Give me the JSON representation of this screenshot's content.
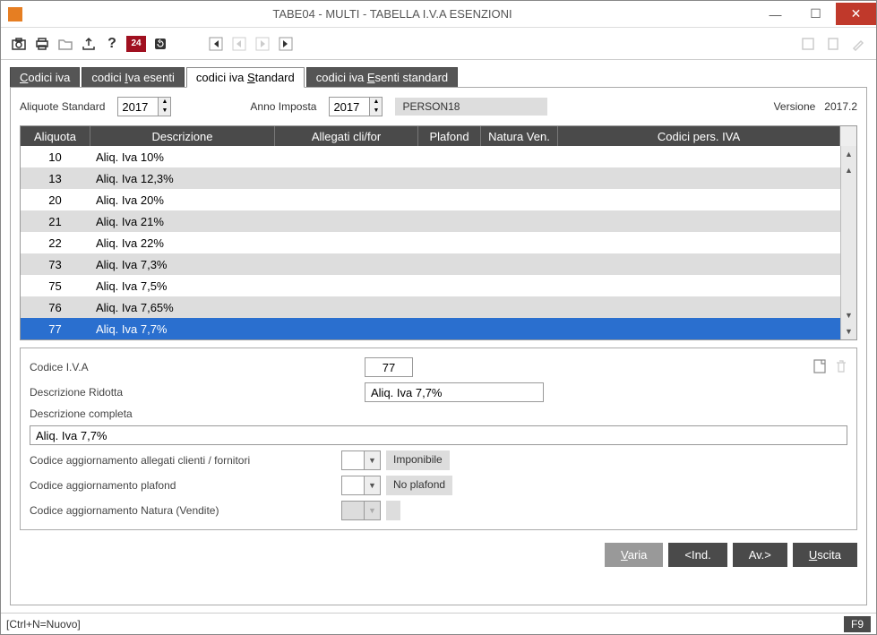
{
  "window": {
    "title": "TABE04  -  MULTI  -   TABELLA I.V.A ESENZIONI"
  },
  "toolbar": {
    "badge_24": "24"
  },
  "tabs": [
    {
      "pre": "",
      "u": "C",
      "post": "odici iva"
    },
    {
      "pre": "codici ",
      "u": "I",
      "post": "va esenti"
    },
    {
      "pre": "codici iva ",
      "u": "S",
      "post": "tandard"
    },
    {
      "pre": "codici iva ",
      "u": "E",
      "post": "senti standard"
    }
  ],
  "filters": {
    "label_standard": "Aliquote Standard",
    "year_standard": "2017",
    "label_anno": "Anno Imposta",
    "year_imposta": "2017",
    "person": "PERSON18",
    "version_label": "Versione",
    "version_value": "2017.2"
  },
  "columns": {
    "aliq": "Aliquota",
    "desc": "Descrizione",
    "alleg": "Allegati cli/for",
    "plaf": "Plafond",
    "nat": "Natura Ven.",
    "cod": "Codici pers. IVA"
  },
  "rows": [
    {
      "aliq": "10",
      "desc": "Aliq. Iva 10%"
    },
    {
      "aliq": "13",
      "desc": "Aliq. Iva 12,3%"
    },
    {
      "aliq": "20",
      "desc": "Aliq. Iva 20%"
    },
    {
      "aliq": "21",
      "desc": "Aliq. Iva 21%"
    },
    {
      "aliq": "22",
      "desc": "Aliq. Iva 22%"
    },
    {
      "aliq": "73",
      "desc": "Aliq. Iva 7,3%"
    },
    {
      "aliq": "75",
      "desc": "Aliq. Iva 7,5%"
    },
    {
      "aliq": "76",
      "desc": "Aliq. Iva 7,65%"
    },
    {
      "aliq": "77",
      "desc": "Aliq. Iva 7,7%"
    }
  ],
  "selected_index": 8,
  "detail": {
    "label_codice": "Codice I.V.A",
    "val_codice": "77",
    "label_ridotta": "Descrizione Ridotta",
    "val_ridotta": "Aliq. Iva 7,7%",
    "label_completa": "Descrizione completa",
    "val_completa": "Aliq. Iva 7,7%",
    "label_allegati": "Codice aggiornamento allegati clienti / fornitori",
    "val_allegati_text": "Imponibile",
    "label_plafond": "Codice aggiornamento plafond",
    "val_plafond_text": "No plafond",
    "label_natura": "Codice aggiornamento Natura (Vendite)",
    "val_natura_text": ""
  },
  "actions": {
    "varia_pre": "",
    "varia_u": "V",
    "varia_post": "aria",
    "ind": "<Ind.",
    "av": "Av.>",
    "uscita_pre": "",
    "uscita_u": "U",
    "uscita_post": "scita"
  },
  "statusbar": {
    "left": "[Ctrl+N=Nuovo]",
    "right": "F9"
  }
}
